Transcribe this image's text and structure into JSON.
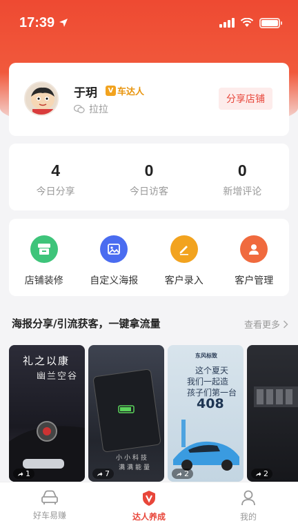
{
  "status_bar": {
    "time": "17:39"
  },
  "profile": {
    "name": "于玥",
    "badge_label": "车达人",
    "sub_label": "拉拉",
    "share_button": "分享店铺"
  },
  "stats": [
    {
      "value": "4",
      "label": "今日分享"
    },
    {
      "value": "0",
      "label": "今日访客"
    },
    {
      "value": "0",
      "label": "新增评论"
    }
  ],
  "tools": [
    {
      "label": "店铺装修",
      "icon": "store-icon",
      "color": "#3ec47a"
    },
    {
      "label": "自定义海报",
      "icon": "image-icon",
      "color": "#4a6cf0"
    },
    {
      "label": "客户录入",
      "icon": "pencil-icon",
      "color": "#f2a31f"
    },
    {
      "label": "客户管理",
      "icon": "person-icon",
      "color": "#f06a3e"
    }
  ],
  "section": {
    "title": "海报分享/引流获客，一键拿流量",
    "more": "查看更多"
  },
  "posters": [
    {
      "count": "1",
      "headline": "礼之以康",
      "subline": "幽兰空谷"
    },
    {
      "count": "7",
      "headline": "小小科技",
      "subline": "满满能量"
    },
    {
      "count": "2",
      "brand": "东风标致",
      "headline": "这个夏天",
      "subline": "我们一起造",
      "subline2": "孩子们第一台",
      "model": "408"
    },
    {
      "count": "2"
    }
  ],
  "tabbar": [
    {
      "label": "好车易赚",
      "active": false
    },
    {
      "label": "达人养成",
      "active": true
    },
    {
      "label": "我的",
      "active": false
    }
  ],
  "colors": {
    "accent": "#e8463a",
    "header": "#ee4a32"
  }
}
